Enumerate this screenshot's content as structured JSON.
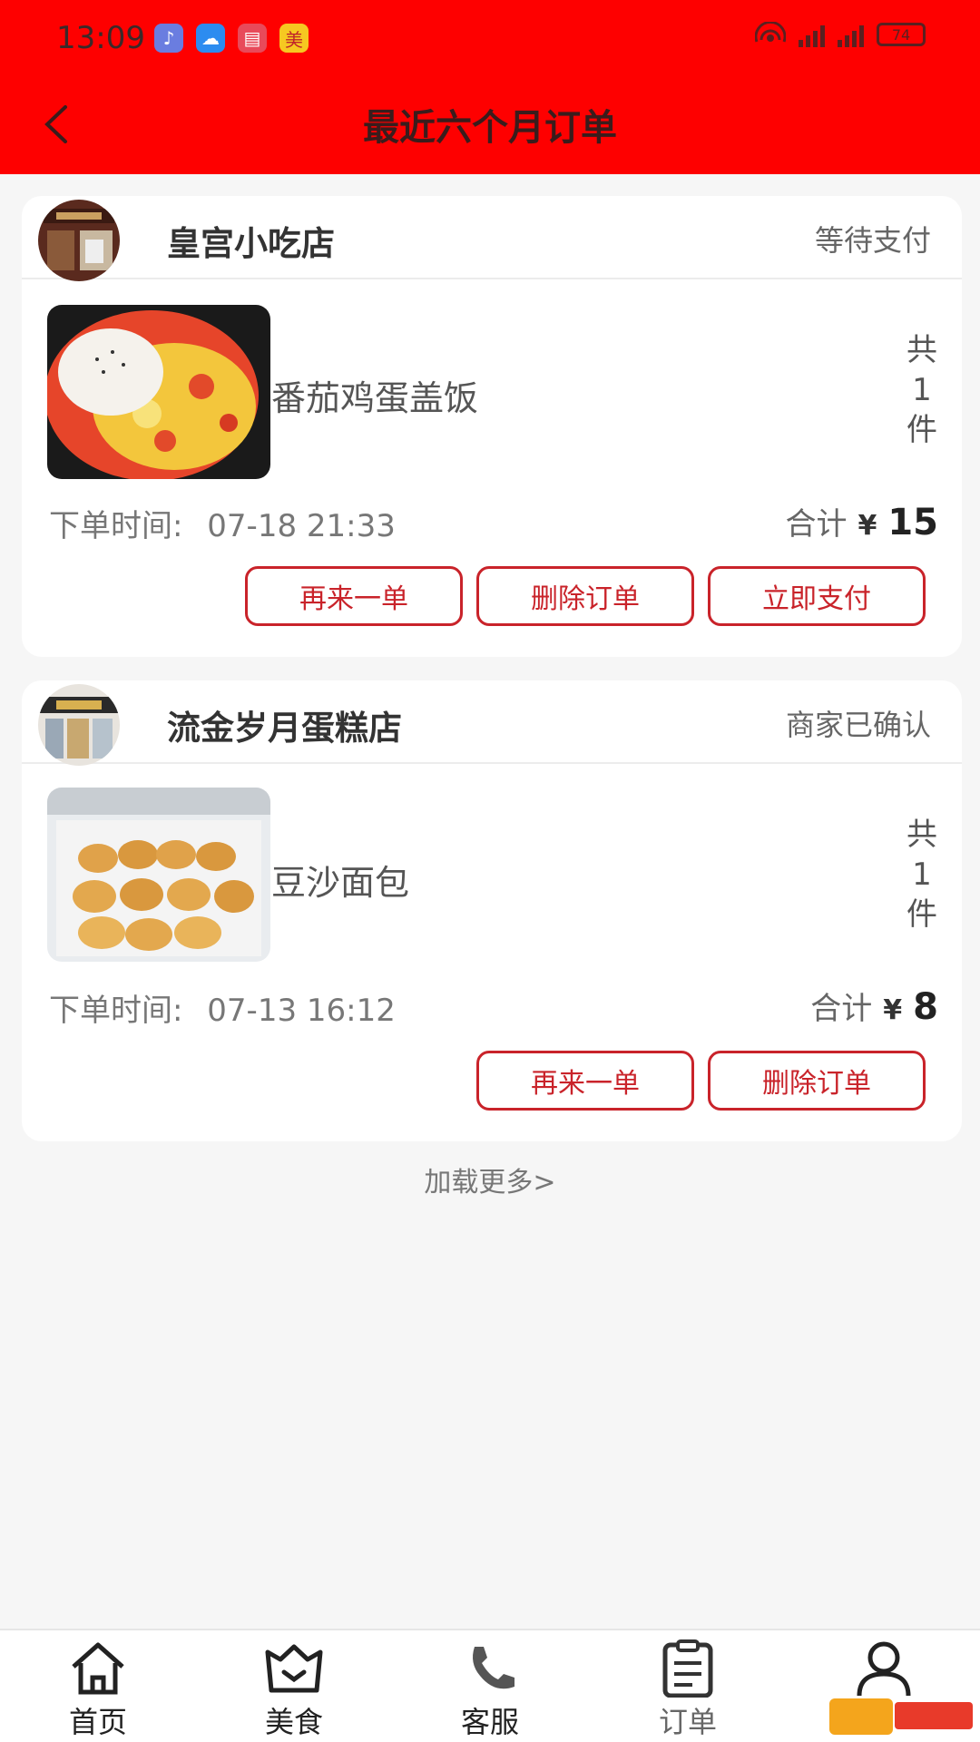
{
  "status_bar": {
    "time": "13:09",
    "apps": [
      {
        "icon": "music-app-icon",
        "glyph": "♪",
        "color": "#6a7de0"
      },
      {
        "icon": "weather-app-icon",
        "glyph": "☁",
        "color": "#2c8cf0"
      },
      {
        "icon": "book-app-icon",
        "glyph": "▤",
        "color": "#e84a5a"
      },
      {
        "icon": "meituan-app-icon",
        "glyph": "美",
        "color": "#f6c821"
      }
    ],
    "battery": "74"
  },
  "header": {
    "title": "最近六个月订单",
    "color": "#fe0000"
  },
  "orders": [
    {
      "shop_name": "皇宫小吃店",
      "status": "等待支付",
      "item_name": "番茄鸡蛋盖饭",
      "count_chars": [
        "共",
        "1",
        "件"
      ],
      "time_label": "下单时间:",
      "time_value": "07-18 21:33",
      "total_label": "合计",
      "currency": "¥",
      "total": "15",
      "buttons": [
        "再来一单",
        "删除订单",
        "立即支付"
      ]
    },
    {
      "shop_name": "流金岁月蛋糕店",
      "status": "商家已确认",
      "item_name": "豆沙面包",
      "count_chars": [
        "共",
        "1",
        "件"
      ],
      "time_label": "下单时间:",
      "time_value": "07-13 16:12",
      "total_label": "合计",
      "currency": "¥",
      "total": "8",
      "buttons": [
        "再来一单",
        "删除订单"
      ]
    }
  ],
  "load_more": "加载更多>",
  "nav": [
    {
      "label": "首页",
      "icon": "home-icon"
    },
    {
      "label": "美食",
      "icon": "food-icon"
    },
    {
      "label": "客服",
      "icon": "phone-icon"
    },
    {
      "label": "订单",
      "icon": "order-icon"
    },
    {
      "label": "",
      "icon": "user-icon"
    }
  ],
  "accent": "#c9232a"
}
